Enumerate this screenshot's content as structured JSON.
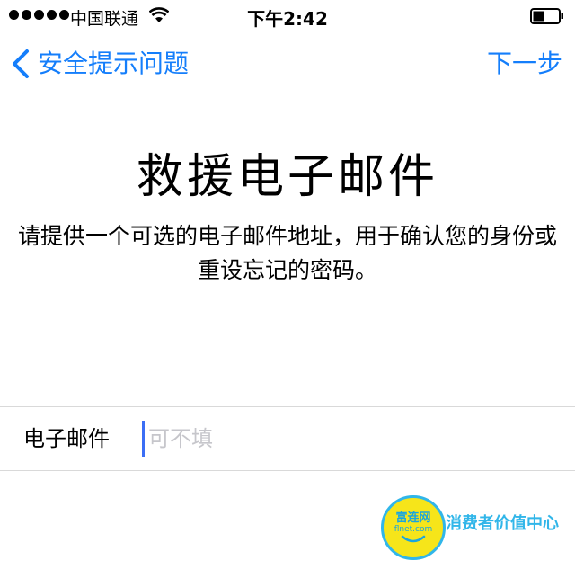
{
  "status_bar": {
    "carrier": "中国联通",
    "time": "下午2:42",
    "signal_dots": 5,
    "battery_level": 0.45
  },
  "nav": {
    "back_label": "安全提示问题",
    "next_label": "下一步",
    "accent_color": "#147efb",
    "back_icon": "chevron-left-icon"
  },
  "main": {
    "title": "救援电子邮件",
    "description": "请提供一个可选的电子邮件地址，用于确认您的身份或重设忘记的密码。"
  },
  "form": {
    "email_label": "电子邮件",
    "email_value": "",
    "email_placeholder": "可不填"
  },
  "watermark": {
    "brand": "富连网",
    "domain": "flnet.com",
    "slogan": "消费者价值中心"
  }
}
